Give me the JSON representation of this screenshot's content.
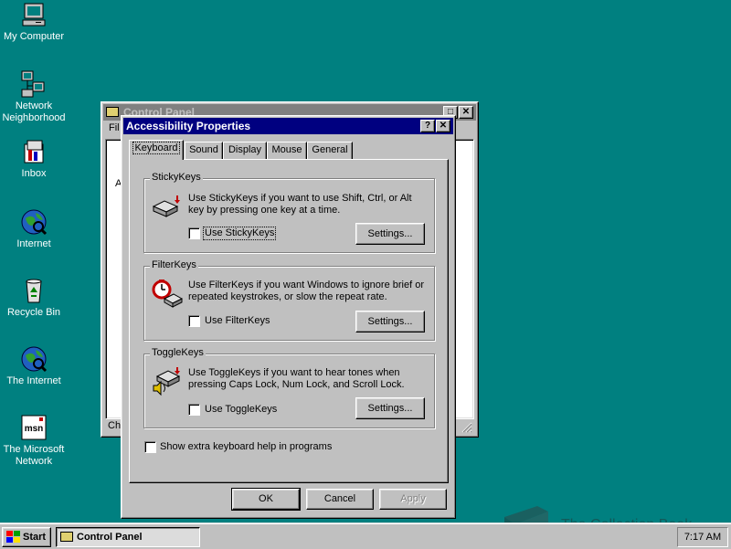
{
  "desktop_icons": [
    {
      "label": "My Computer",
      "icon": "computer-icon"
    },
    {
      "label": "Network Neighborhood",
      "icon": "network-icon"
    },
    {
      "label": "Inbox",
      "icon": "inbox-icon"
    },
    {
      "label": "Internet",
      "icon": "internet-globe-icon"
    },
    {
      "label": "Recycle Bin",
      "icon": "recycle-bin-icon"
    },
    {
      "label": "The Internet",
      "icon": "internet-globe-icon"
    },
    {
      "label": "The Microsoft Network",
      "icon": "msn-icon"
    }
  ],
  "control_panel": {
    "title": "Control Panel",
    "menu_first": "Fil",
    "body_char": "A",
    "status_prefix": "Ch"
  },
  "dialog": {
    "title": "Accessibility Properties",
    "help_btn": "?",
    "close_btn": "✕",
    "tabs": [
      "Keyboard",
      "Sound",
      "Display",
      "Mouse",
      "General"
    ],
    "active_tab": "Keyboard",
    "groups": {
      "sticky": {
        "label": "StickyKeys",
        "desc_line1": "Use StickyKeys if you want to use Shift, Ctrl, or Alt",
        "desc_line2": "key by pressing one key at a time.",
        "checkbox_label": "Use StickyKeys",
        "settings": "Settings..."
      },
      "filter": {
        "label": "FilterKeys",
        "desc_line1": "Use FilterKeys if you want Windows to ignore brief or",
        "desc_line2": "repeated keystrokes, or slow the repeat rate.",
        "checkbox_label": "Use FilterKeys",
        "settings": "Settings..."
      },
      "toggle": {
        "label": "ToggleKeys",
        "desc_line1": "Use ToggleKeys if you want to hear tones when",
        "desc_line2": "pressing Caps Lock, Num Lock, and Scroll Lock.",
        "checkbox_label": "Use ToggleKeys",
        "settings": "Settings..."
      }
    },
    "extra_help_label": "Show extra keyboard help in programs",
    "ok": "OK",
    "cancel": "Cancel",
    "apply": "Apply"
  },
  "taskbar": {
    "start": "Start",
    "task": "Control Panel",
    "clock": "7:17 AM"
  },
  "watermark": "The Collection Book",
  "colors": {
    "desktop": "#008080",
    "title_active": "#000080",
    "title_inactive": "#808080",
    "face": "#c0c0c0"
  }
}
